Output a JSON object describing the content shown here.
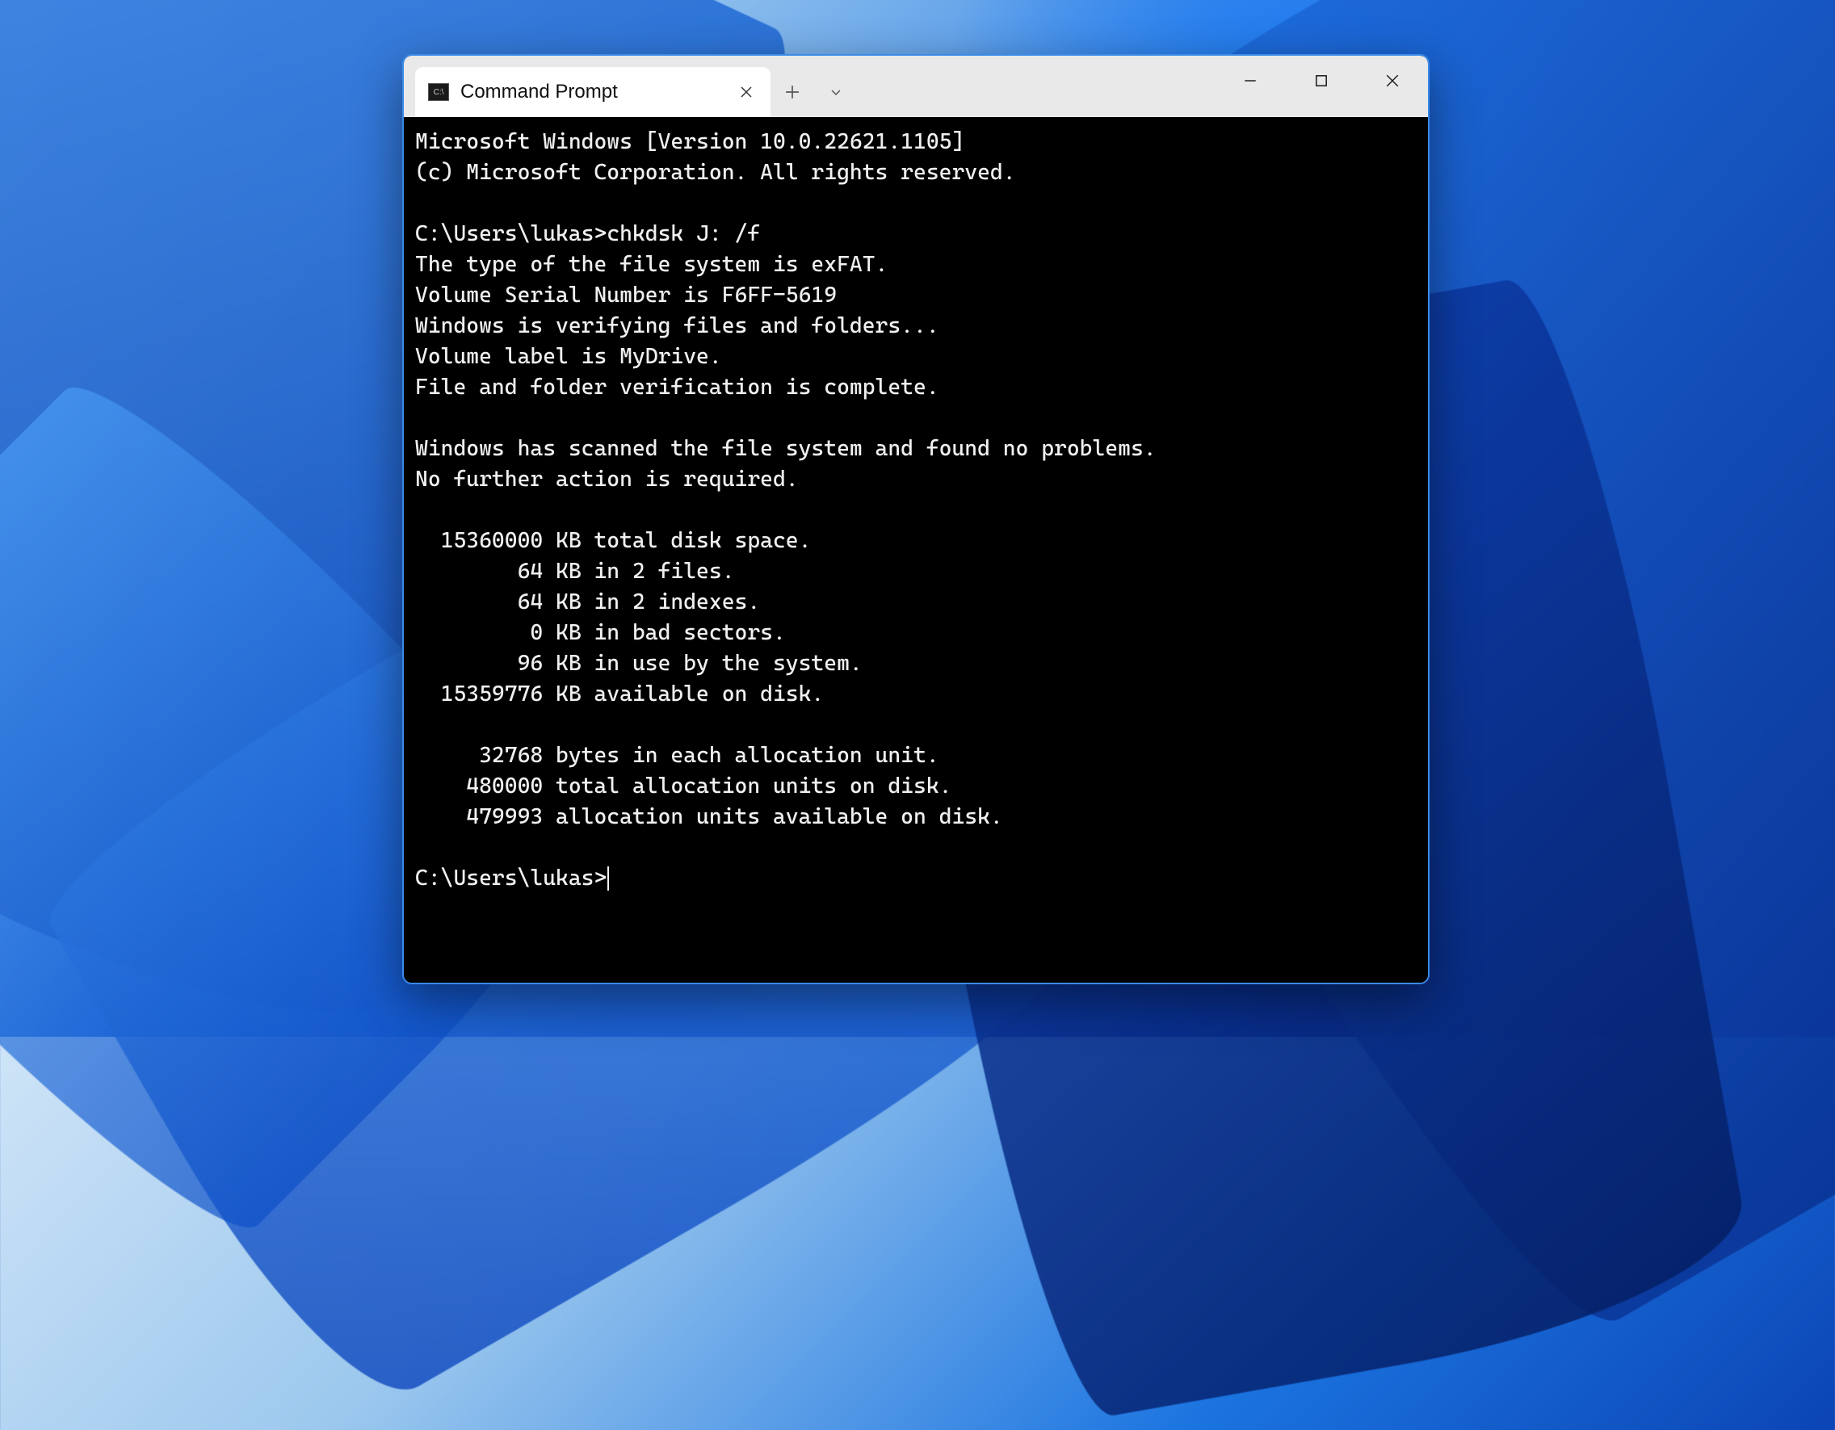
{
  "tab": {
    "title": "Command Prompt"
  },
  "terminal": {
    "banner1": "Microsoft Windows [Version 10.0.22621.1105]",
    "banner2": "(c) Microsoft Corporation. All rights reserved.",
    "prompt1": "C:\\Users\\lukas>",
    "command1": "chkdsk J: /f",
    "l1": "The type of the file system is exFAT.",
    "l2": "Volume Serial Number is F6FF-5619",
    "l3": "Windows is verifying files and folders...",
    "l4": "Volume label is MyDrive.",
    "l5": "File and folder verification is complete.",
    "l6": "Windows has scanned the file system and found no problems.",
    "l7": "No further action is required.",
    "s1": "  15360000 KB total disk space.",
    "s2": "        64 KB in 2 files.",
    "s3": "        64 KB in 2 indexes.",
    "s4": "         0 KB in bad sectors.",
    "s5": "        96 KB in use by the system.",
    "s6": "  15359776 KB available on disk.",
    "a1": "     32768 bytes in each allocation unit.",
    "a2": "    480000 total allocation units on disk.",
    "a3": "    479993 allocation units available on disk.",
    "prompt2": "C:\\Users\\lukas>"
  }
}
